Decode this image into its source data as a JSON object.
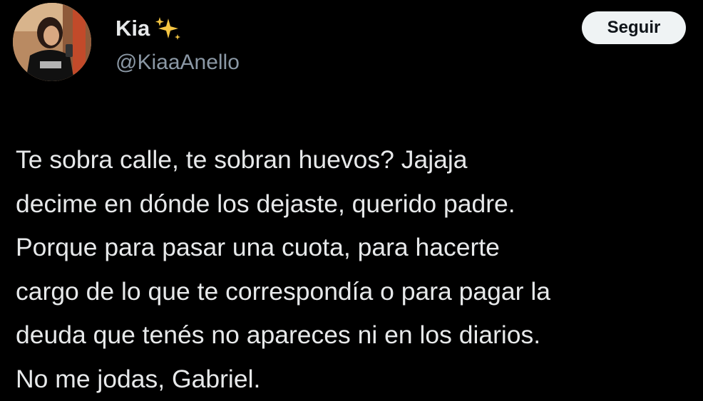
{
  "author": {
    "display_name": "Kia",
    "name_emoji": "sparkles-icon",
    "handle": "@KiaaAnello",
    "avatar": "profile-photo"
  },
  "follow_button": {
    "label": "Seguir"
  },
  "tweet": {
    "lines": [
      "Te sobra calle, te sobran huevos? Jajaja",
      "decime en dónde los dejaste, querido padre.",
      "Porque para pasar una cuota, para hacerte",
      "cargo de lo que te correspondía o para pagar la",
      "deuda que tenés no apareces ni en los diarios.",
      "No me jodas, Gabriel."
    ]
  },
  "colors": {
    "background": "#000000",
    "text_primary": "#e7e9ea",
    "text_secondary": "#8b98a5",
    "button_bg": "#eff3f4",
    "button_text": "#0f1419",
    "sparkle": "#f4c542"
  }
}
